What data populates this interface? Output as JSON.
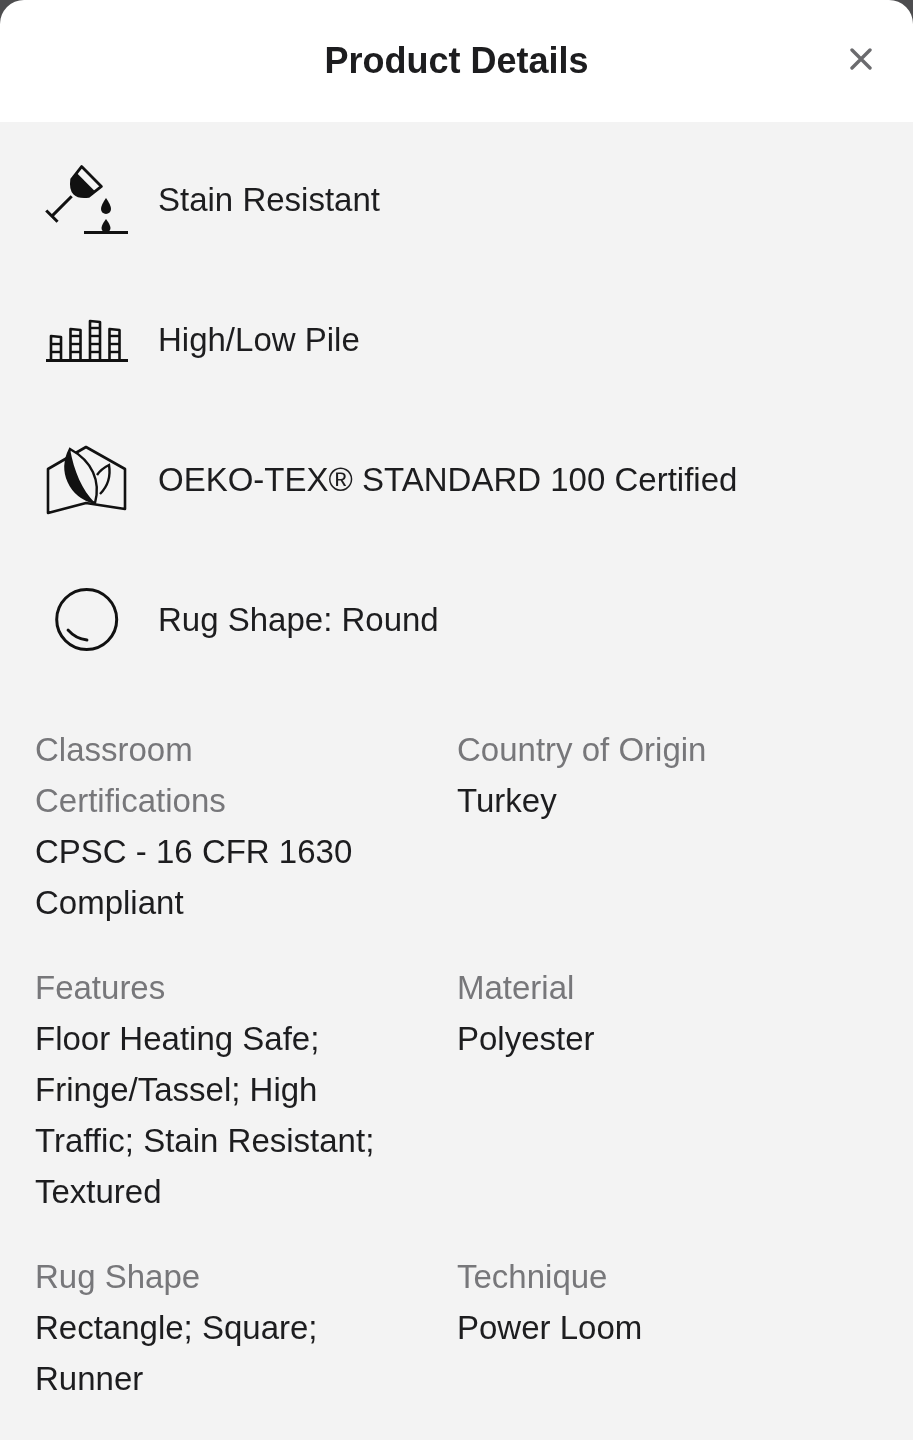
{
  "header": {
    "title": "Product Details"
  },
  "features": [
    {
      "kind": "stain",
      "label": "Stain Resistant"
    },
    {
      "kind": "pile",
      "label": "High/Low Pile"
    },
    {
      "kind": "oeko",
      "label": "OEKO-TEX® STANDARD 100 Certified"
    },
    {
      "kind": "round",
      "label": "Rug Shape: Round"
    }
  ],
  "specs": [
    {
      "label": "Classroom Certifications",
      "value": "CPSC - 16 CFR 1630 Compliant"
    },
    {
      "label": "Country of Origin",
      "value": "Turkey"
    },
    {
      "label": "Features",
      "value": "Floor Heating Safe; Fringe/Tassel; High Traffic; Stain Resistant; Textured"
    },
    {
      "label": "Material",
      "value": "Polyester"
    },
    {
      "label": "Rug Shape",
      "value": "Rectangle; Square; Runner"
    },
    {
      "label": "Technique",
      "value": "Power Loom"
    }
  ]
}
